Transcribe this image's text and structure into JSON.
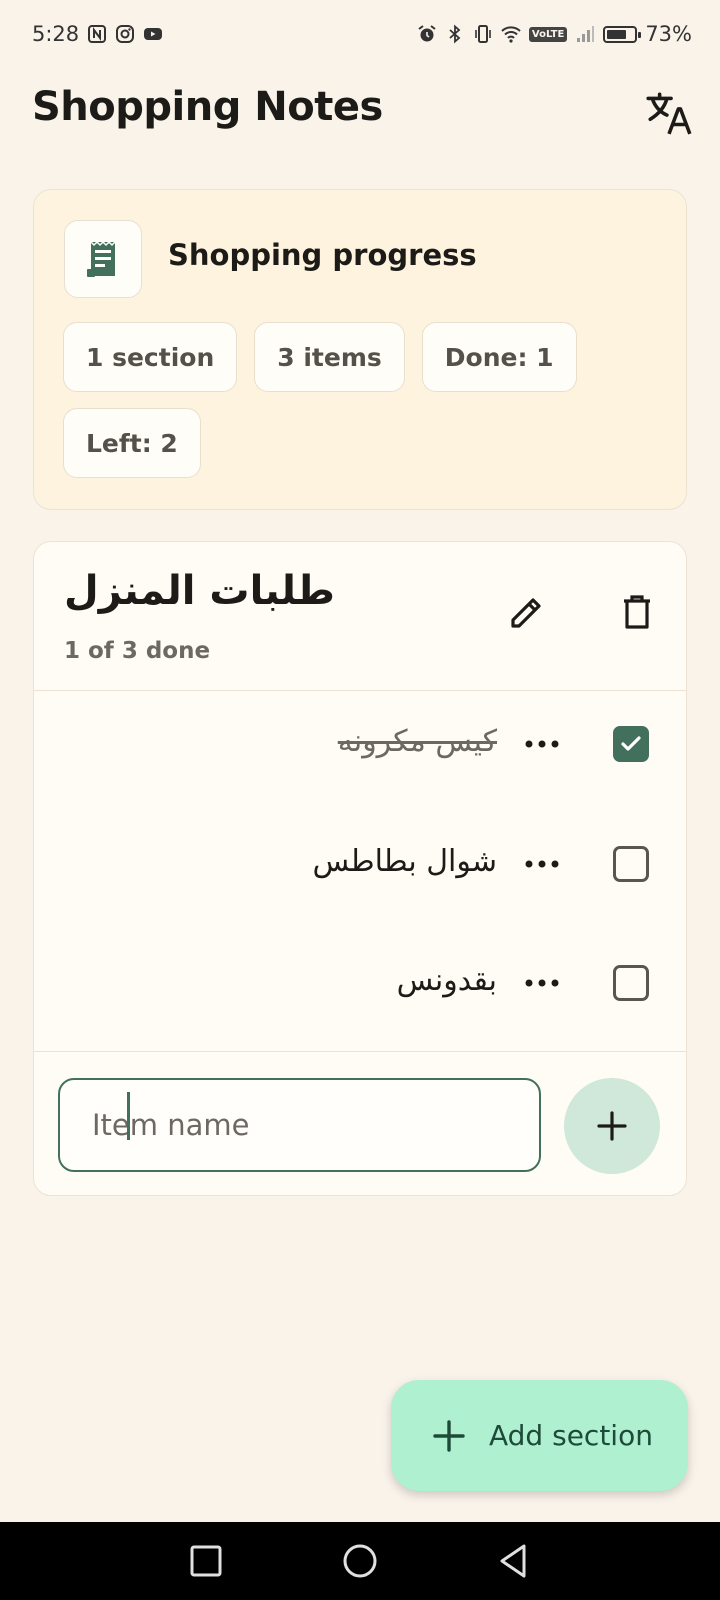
{
  "status_bar": {
    "time": "5:28",
    "volte": "VoLTE",
    "battery": "73%",
    "battery_level": 0.73
  },
  "app": {
    "title": "Shopping Notes",
    "translate_icon": "translate-icon"
  },
  "progress": {
    "title": "Shopping progress",
    "icon": "receipt-icon",
    "chips": [
      "1 section",
      "3 items",
      "Done: 1",
      "Left: 2"
    ]
  },
  "section": {
    "title": "طلبات المنزل",
    "subtitle": "1 of 3 done",
    "items": [
      {
        "label": "كيس مكرونه",
        "checked": true
      },
      {
        "label": "شوال بطاطس",
        "checked": false
      },
      {
        "label": "بقدونس",
        "checked": false
      }
    ],
    "input_placeholder": "Item name"
  },
  "fab": {
    "label": "Add section"
  },
  "colors": {
    "background": "#f9f3ea",
    "accent": "#43705d",
    "fab": "#aef0d0",
    "progress_card": "#fdf3df"
  }
}
